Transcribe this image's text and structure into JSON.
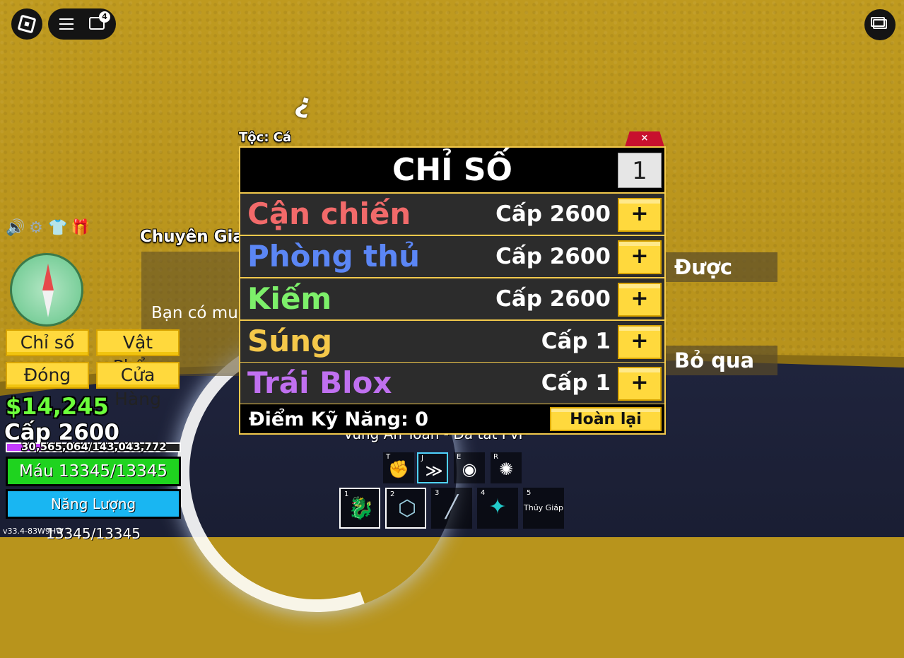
{
  "topbar": {
    "chat_badge": "4"
  },
  "npc": {
    "name": "Chuyên Gia",
    "dialog_text": "Bạn có mu",
    "option_accept": "Được",
    "option_skip": "Bỏ qua"
  },
  "stats_panel": {
    "race_label": "Tộc: Cá",
    "close_label": "×",
    "title": "CHỈ SỐ",
    "amount_input": "1",
    "rows": [
      {
        "name": "Cận chiến",
        "level": "Cấp 2600",
        "plus": "+",
        "color": "#f26a6a"
      },
      {
        "name": "Phòng thủ",
        "level": "Cấp 2600",
        "plus": "+",
        "color": "#5b86f5"
      },
      {
        "name": "Kiếm",
        "level": "Cấp 2600",
        "plus": "+",
        "color": "#7df06a"
      },
      {
        "name": "Súng",
        "level": "Cấp 1",
        "plus": "+",
        "color": "#f5c84a"
      },
      {
        "name": "Trái Blox",
        "level": "Cấp 1",
        "plus": "+",
        "color": "#c070f0"
      }
    ],
    "skill_points": "Điểm Kỹ Năng: 0",
    "reset_label": "Hoàn lại"
  },
  "left_menu": {
    "stats": "Chỉ số",
    "items": "Vật Phẩm",
    "close": "Đóng",
    "shop": "Cửa Hàng"
  },
  "player": {
    "money": "$14,245",
    "level": "Cấp 2600",
    "xp_text": "30,565,064/143,043,772",
    "xp_fraction": 0.2137,
    "health_text": "Máu 13345/13345",
    "health_fraction": 1.0,
    "energy_text": "Năng Lượng 13345/13345",
    "energy_fraction": 1.0
  },
  "zone_text": "Vùng An Toàn - Đã tắt PvP",
  "version": "v33.4-83W9HW",
  "abilities": [
    {
      "key": "T",
      "icon": "fist-icon"
    },
    {
      "key": "J",
      "icon": "dash-icon"
    },
    {
      "key": "E",
      "icon": "eye-icon"
    },
    {
      "key": "R",
      "icon": "burst-icon"
    }
  ],
  "hotbar": [
    {
      "key": "1",
      "label": "",
      "icon": "dragon-icon"
    },
    {
      "key": "2",
      "label": "",
      "icon": "shield-icon"
    },
    {
      "key": "3",
      "label": "",
      "icon": "katana-icon"
    },
    {
      "key": "4",
      "label": "",
      "icon": "trident-icon"
    },
    {
      "key": "5",
      "label": "Thủy Giáp",
      "icon": ""
    }
  ]
}
